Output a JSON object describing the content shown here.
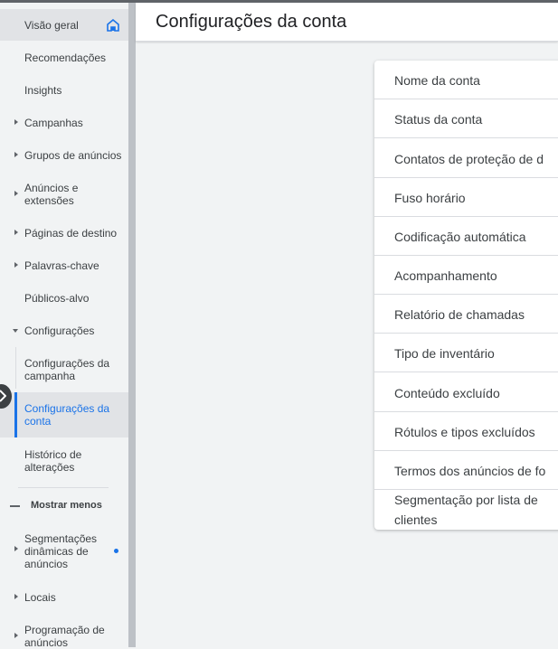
{
  "header": {
    "title": "Configurações da conta"
  },
  "sidebar": {
    "items": [
      {
        "label": "Visão geral"
      },
      {
        "label": "Recomendações"
      },
      {
        "label": "Insights"
      },
      {
        "label": "Campanhas"
      },
      {
        "label": "Grupos de anúncios"
      },
      {
        "label": "Anúncios e extensões"
      },
      {
        "label": "Páginas de destino"
      },
      {
        "label": "Palavras-chave"
      },
      {
        "label": "Públicos-alvo"
      },
      {
        "label": "Configurações"
      },
      {
        "label": "Configurações da campanha"
      },
      {
        "label": "Configurações da conta"
      },
      {
        "label": "Histórico de alterações"
      },
      {
        "label": "Segmentações dinâmicas de anúncios"
      },
      {
        "label": "Locais"
      },
      {
        "label": "Programação de anúncios"
      }
    ],
    "show_less": "Mostrar menos"
  },
  "settings": {
    "rows": [
      {
        "label": "Nome da conta"
      },
      {
        "label": "Status da conta"
      },
      {
        "label": "Contatos de proteção de d"
      },
      {
        "label": "Fuso horário"
      },
      {
        "label": "Codificação automática"
      },
      {
        "label": "Acompanhamento"
      },
      {
        "label": "Relatório de chamadas"
      },
      {
        "label": "Tipo de inventário"
      },
      {
        "label": "Conteúdo excluído"
      },
      {
        "label": "Rótulos e tipos excluídos"
      },
      {
        "label": "Termos dos anúncios de fo"
      },
      {
        "label": "Segmentação por lista de clientes"
      }
    ]
  },
  "colors": {
    "accent": "#1a73e8",
    "sidebar_bg": "#f1f3f4",
    "text": "#3c4043"
  }
}
